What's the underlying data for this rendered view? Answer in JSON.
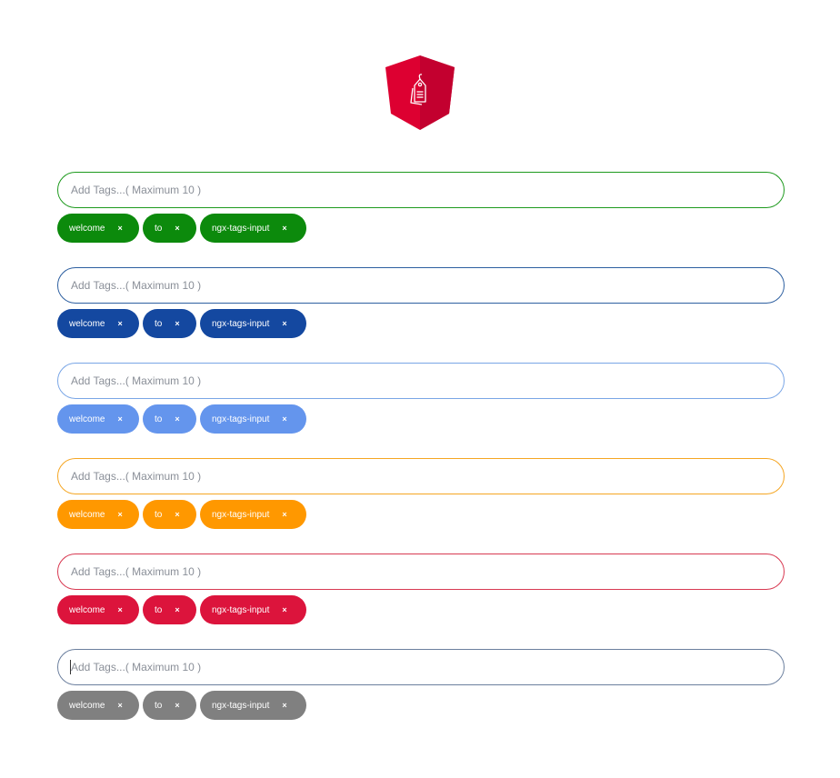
{
  "logo": {
    "icon": "tag-icon",
    "color": "#dd0031"
  },
  "tag_inputs": [
    {
      "placeholder": "Add Tags...( Maximum 10 )",
      "border_color": "#1e9a1e",
      "tag_color": "#0c8a0c",
      "tags": [
        "welcome",
        "to",
        "ngx-tags-input"
      ],
      "remove_glyph": "×"
    },
    {
      "placeholder": "Add Tags...( Maximum 10 )",
      "border_color": "#2d5fa0",
      "tag_color": "#1448a0",
      "tags": [
        "welcome",
        "to",
        "ngx-tags-input"
      ],
      "remove_glyph": "×"
    },
    {
      "placeholder": "Add Tags...( Maximum 10 )",
      "border_color": "#7aa6e6",
      "tag_color": "#6495ed",
      "tags": [
        "welcome",
        "to",
        "ngx-tags-input"
      ],
      "remove_glyph": "×"
    },
    {
      "placeholder": "Add Tags...( Maximum 10 )",
      "border_color": "#f5a623",
      "tag_color": "#ff9800",
      "tags": [
        "welcome",
        "to",
        "ngx-tags-input"
      ],
      "remove_glyph": "×"
    },
    {
      "placeholder": "Add Tags...( Maximum 10 )",
      "border_color": "#d83a52",
      "tag_color": "#dc143c",
      "tags": [
        "welcome",
        "to",
        "ngx-tags-input"
      ],
      "remove_glyph": "×"
    },
    {
      "placeholder": "Add Tags...( Maximum 10 )",
      "border_color": "#6b7f9e",
      "tag_color": "#808080",
      "tags": [
        "welcome",
        "to",
        "ngx-tags-input"
      ],
      "remove_glyph": "×",
      "focused": true
    }
  ]
}
